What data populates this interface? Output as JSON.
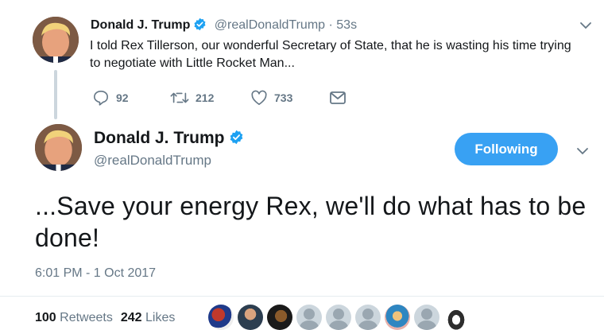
{
  "parent_tweet": {
    "display_name": "Donald J. Trump",
    "handle": "@realDonaldTrump",
    "age": "53s",
    "text": "I told Rex Tillerson, our wonderful Secretary of State, that he is wasting his time trying to negotiate with Little Rocket Man...",
    "reply_count": "92",
    "retweet_count": "212",
    "like_count": "733"
  },
  "focused_tweet": {
    "display_name": "Donald J. Trump",
    "handle": "@realDonaldTrump",
    "follow_label": "Following",
    "text": "...Save your energy Rex, we'll do what has to be done!",
    "timestamp": "6:01 PM - 1 Oct 2017",
    "retweets_count": "100",
    "retweets_label": "Retweets",
    "likes_count": "242",
    "likes_label": "Likes"
  },
  "icons": {
    "verified": "verified-badge-icon",
    "reply": "reply-icon",
    "retweet": "retweet-icon",
    "like": "heart-icon",
    "dm": "envelope-icon",
    "more": "chevron-down-icon"
  },
  "colors": {
    "accent": "#1da1f2",
    "follow_button": "#38a1f3",
    "muted_text": "#657786",
    "thread_line": "#ccd6dd"
  }
}
